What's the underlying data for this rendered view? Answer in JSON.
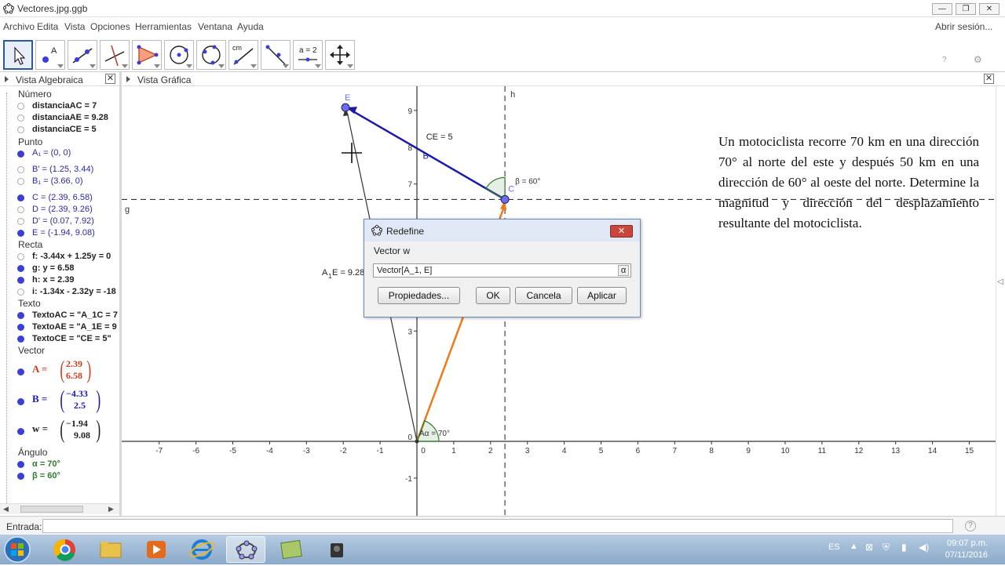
{
  "window": {
    "title": "Vectores.jpg.ggb"
  },
  "menu": {
    "items": [
      "Archivo",
      "Edita",
      "Vista",
      "Opciones",
      "Herramientas",
      "Ventana",
      "Ayuda"
    ],
    "signin": "Abrir sesión..."
  },
  "toolbar": {
    "tools": [
      "move-tool",
      "point-tool",
      "line-tool",
      "perpendicular-tool",
      "polygon-tool",
      "circle-tool",
      "circle-three-points-tool",
      "distance-tool",
      "angle-tool",
      "slider-tool",
      "move-view-tool"
    ],
    "slider_label": "a = 2",
    "distance_label": "cm",
    "undo": "↶",
    "redo": "↷"
  },
  "algebra": {
    "header": "Vista Algebraica",
    "categories": {
      "numero": "Número",
      "punto": "Punto",
      "recta": "Recta",
      "texto": "Texto",
      "vector": "Vector",
      "angulo": "Ángulo"
    },
    "numero": [
      "distanciaAC = 7",
      "distanciaAE = 9.28",
      "distanciaCE = 5"
    ],
    "punto": [
      "A₁ = (0, 0)",
      "B' = (1.25, 3.44)",
      "B₁ = (3.66, 0)",
      "C = (2.39, 6.58)",
      "D = (2.39, 9.26)",
      "D' = (0.07, 7.92)",
      "E = (-1.94, 9.08)"
    ],
    "recta": [
      "f: -3.44x + 1.25y = 0",
      "g: y = 6.58",
      "h: x = 2.39",
      "i: -1.34x - 2.32y = -18"
    ],
    "texto": [
      "TextoAC = \"A_1C = 7",
      "TextoAE = \"A_1E = 9",
      "TextoCE = \"CE = 5\""
    ],
    "vector_names": [
      "A =",
      "B =",
      "w ="
    ],
    "vector_vals": [
      [
        "2.39",
        "6.58"
      ],
      [
        "−4.33",
        "2.5"
      ],
      [
        "−1.94",
        "9.08"
      ]
    ],
    "angulo": [
      "α = 70°",
      "β = 60°"
    ]
  },
  "graphics": {
    "header": "Vista Gráfica",
    "x_ticks": [
      "-7",
      "-6",
      "-5",
      "-4",
      "-3",
      "-2",
      "-1",
      "0",
      "1",
      "2",
      "3",
      "4",
      "5",
      "6",
      "7",
      "8",
      "9",
      "10",
      "11",
      "12",
      "13",
      "14",
      "15"
    ],
    "y_ticks": [
      "-1",
      "0",
      "3",
      "4",
      "7",
      "8",
      "9"
    ],
    "labels": {
      "E": "E",
      "C": "C",
      "B": "B",
      "h": "h",
      "g": "g",
      "CE": "CE = 5",
      "A1E_pre": "A",
      "A1E_sub": "1",
      "A1E_post": "E = 9.28",
      "beta": "β = 60°",
      "alpha": "Aα = 70°",
      "frag": "1C"
    },
    "problem": "Un motociclista recorre 70 km en una dirección 70° al norte del este y después 50 km en una dirección de 60° al oeste del norte. Determine la magnitud y dirección del desplazamiento resultante del motociclista."
  },
  "dialog": {
    "title": "Redefine",
    "label": "Vector w",
    "value": "Vector[A_1, E]",
    "alpha": "α",
    "buttons": {
      "props": "Propiedades...",
      "ok": "OK",
      "cancel": "Cancela",
      "apply": "Aplicar"
    },
    "close": "✕"
  },
  "entrada": {
    "label": "Entrada:",
    "help": "?"
  },
  "taskbar": {
    "lang": "ES",
    "time": "09:07 p.m.",
    "date": "07/11/2016"
  },
  "colors": {
    "blue": "#1a1aa8",
    "orange": "#f07a1a",
    "green": "#2e7d2e",
    "point": "#6a6aff"
  }
}
